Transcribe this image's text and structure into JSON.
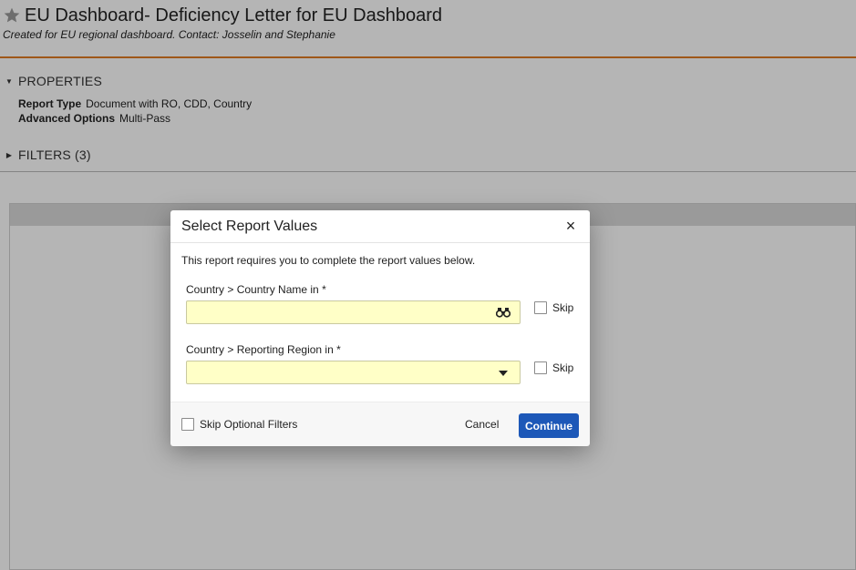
{
  "page": {
    "title": "EU Dashboard- Deficiency Letter for EU Dashboard",
    "subtitle": "Created for EU regional dashboard. Contact: Josselin and Stephanie",
    "properties_heading": "PROPERTIES",
    "properties": [
      {
        "label": "Report Type",
        "value": "Document with RO, CDD, Country"
      },
      {
        "label": "Advanced Options",
        "value": "Multi-Pass"
      }
    ],
    "filters_heading": "FILTERS (3)"
  },
  "dialog": {
    "title": "Select Report Values",
    "close_glyph": "×",
    "intro": "This report requires you to complete the report values below.",
    "fields": [
      {
        "label": "Country > Country Name in *",
        "value": "",
        "skip_label": "Skip",
        "icon": "binoculars-icon"
      },
      {
        "label": "Country > Reporting Region in *",
        "value": "",
        "skip_label": "Skip",
        "icon": "chevron-down-icon"
      }
    ],
    "footer": {
      "skip_optional_label": "Skip Optional Filters",
      "cancel_label": "Cancel",
      "continue_label": "Continue"
    }
  },
  "colors": {
    "accent_line": "#e07b24",
    "continue_button": "#1d58b8",
    "required_field_bg": "#ffffc7"
  }
}
